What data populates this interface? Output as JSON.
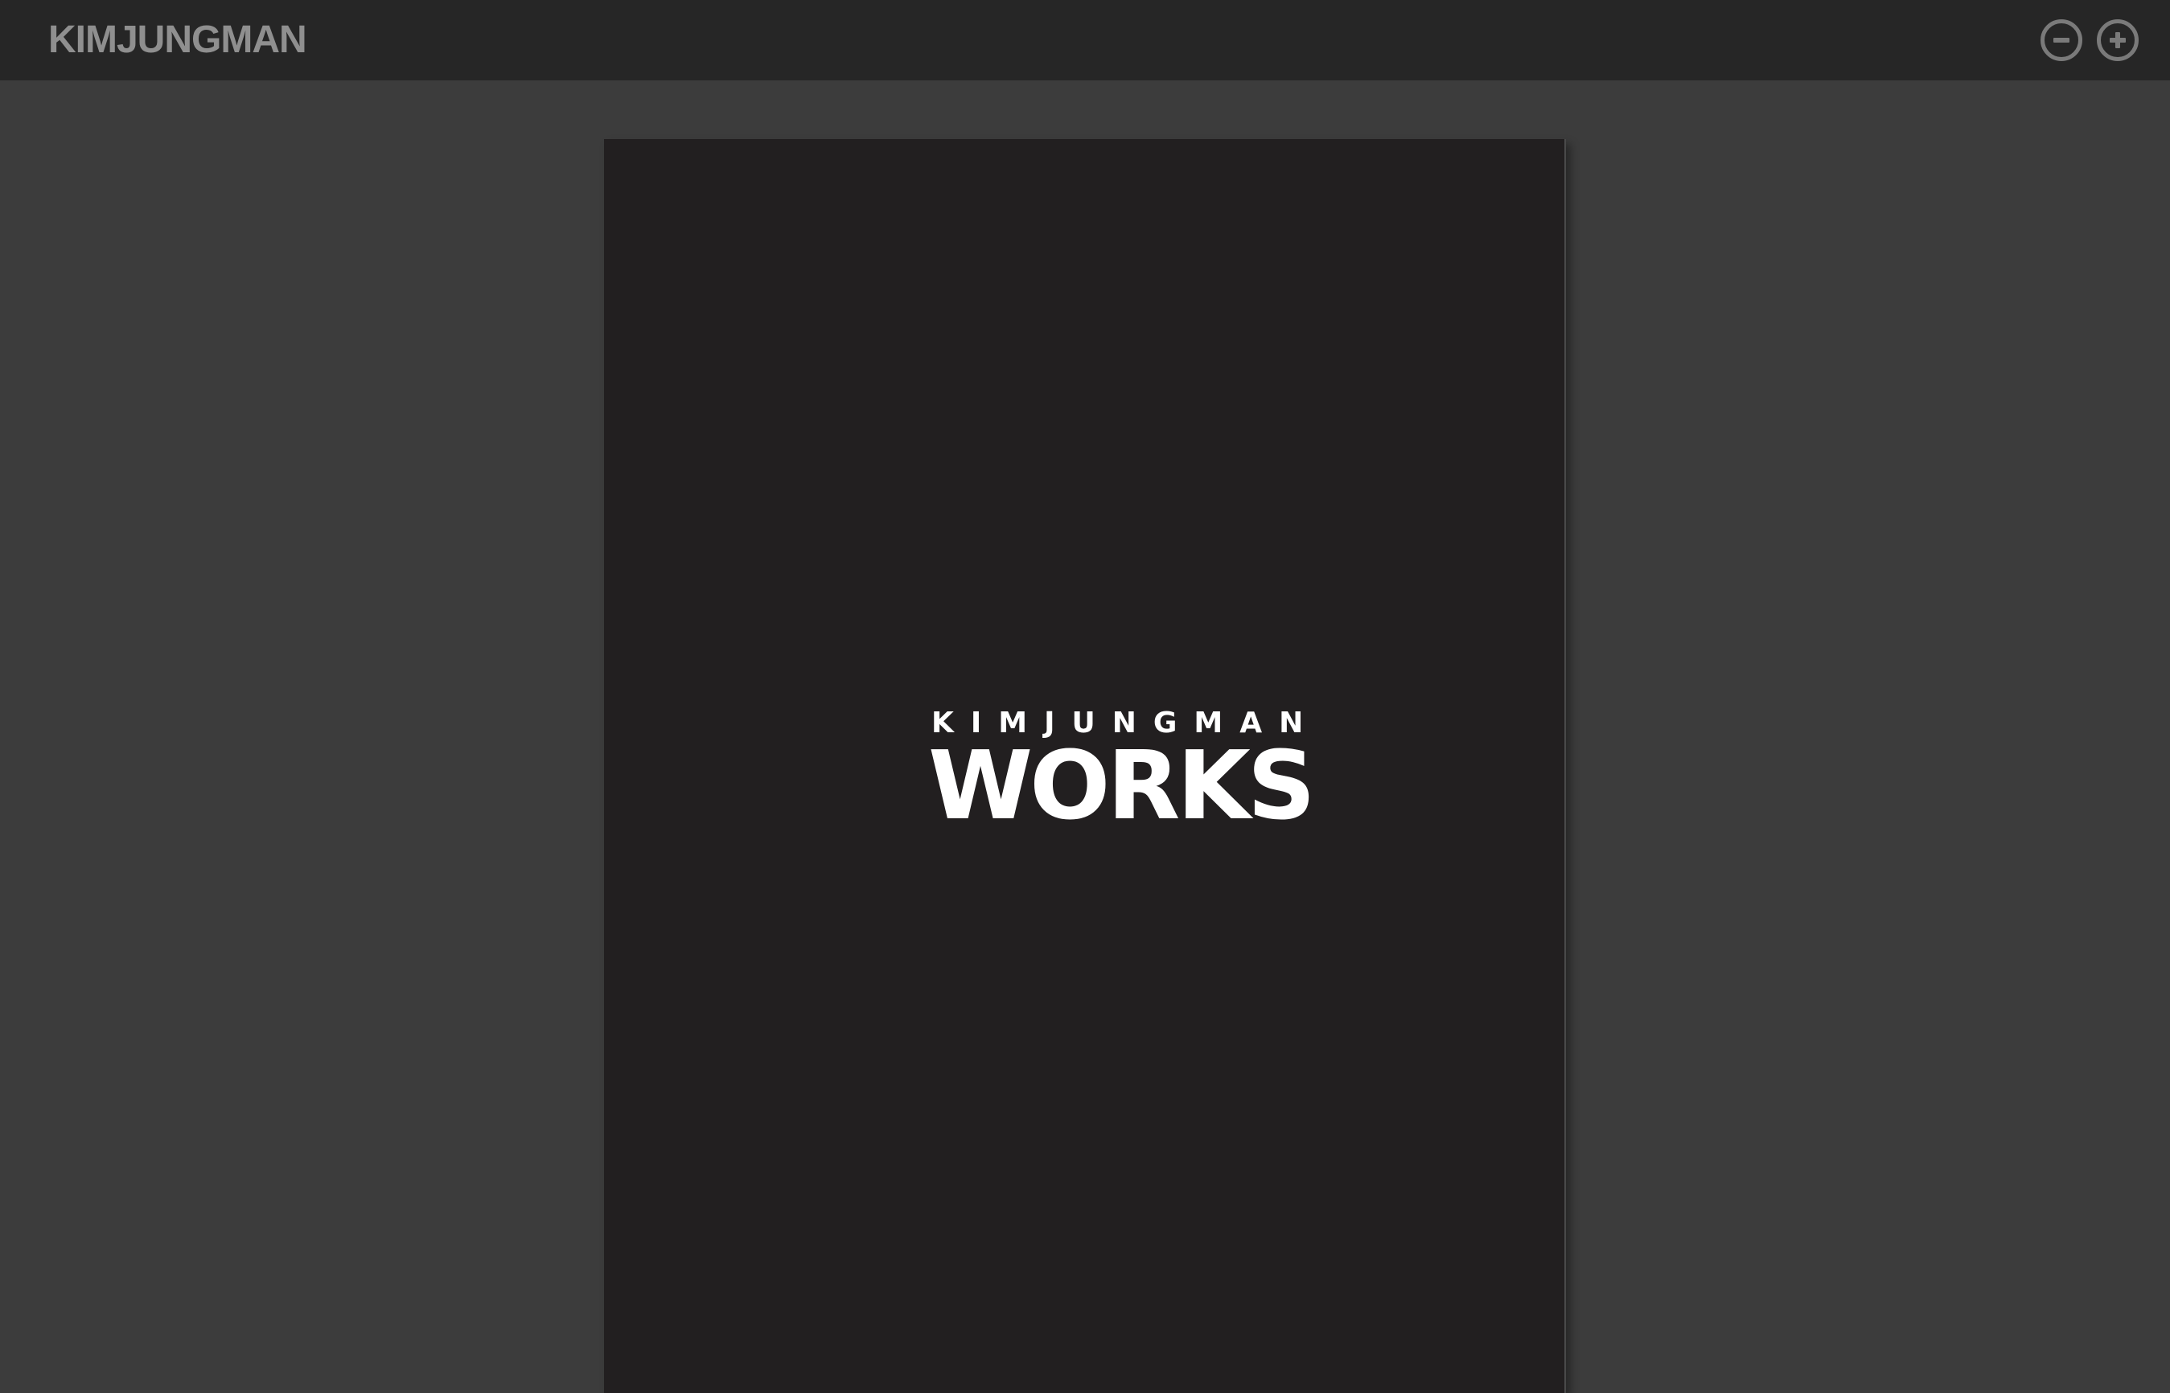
{
  "app": {
    "title": "KIMJUNGMAN"
  },
  "toolbar": {
    "zoom_out_icon": "minus-circle-icon",
    "zoom_in_icon": "plus-circle-icon"
  },
  "document": {
    "cover": {
      "name": "KIMJUNGMAN",
      "title": "WORKS"
    }
  },
  "colors": {
    "topbar_bg": "#262626",
    "viewer_bg": "#3c3c3c",
    "page_bg": "#221f20",
    "title_text": "#8f8f8f",
    "icon": "#7a7a7a",
    "cover_text": "#ffffff"
  }
}
